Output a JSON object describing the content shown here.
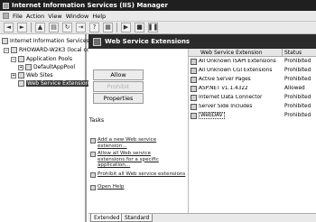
{
  "window": {
    "title": "Internet Information Services (IIS) Manager"
  },
  "menu": [
    "File",
    "Action",
    "View",
    "Window",
    "Help"
  ],
  "toolbar": {
    "back": "◄",
    "forward": "►",
    "up": "▲",
    "props": "▤",
    "refresh": "↻",
    "export": "⇥",
    "help": "?",
    "view": "▦",
    "play": "▶",
    "stop": "■",
    "pause": "❚❚"
  },
  "tree": {
    "items": [
      {
        "label": "Internet Information Services",
        "expander": ""
      },
      {
        "label": "RHOWARD-W2K3 (local cor",
        "expander": "−"
      },
      {
        "label": "Application Pools",
        "expander": "−"
      },
      {
        "label": "DefaultAppPool",
        "expander": "+"
      },
      {
        "label": "Web Sites",
        "expander": "+"
      },
      {
        "label": "Web Service Extension",
        "expander": ""
      }
    ]
  },
  "banner": {
    "title": "Web Service Extensions"
  },
  "buttons": {
    "allow": "Allow",
    "prohibit": "Prohibit",
    "properties": "Properties"
  },
  "tasks": {
    "title": "Tasks",
    "items": [
      {
        "label": "Add a new Web service extension..."
      },
      {
        "label": "Allow all Web service extensions for a specific application..."
      },
      {
        "label": "Prohibit all Web service extensions"
      },
      {
        "label": "Open Help"
      }
    ]
  },
  "list": {
    "columns": {
      "name": "Web Service Extension",
      "status": "Status"
    },
    "rows": [
      {
        "name": "All Unknown ISAPI Extensions",
        "status": "Prohibited"
      },
      {
        "name": "All Unknown CGI Extensions",
        "status": "Prohibited"
      },
      {
        "name": "Active Server Pages",
        "status": "Prohibited"
      },
      {
        "name": "ASP.NET v1.1.4322",
        "status": "Allowed"
      },
      {
        "name": "Internet Data Connector",
        "status": "Prohibited"
      },
      {
        "name": "Server Side Includes",
        "status": "Prohibited"
      },
      {
        "name": "WebDAV",
        "status": "Prohibited"
      }
    ]
  },
  "tabs": {
    "extended": "Extended",
    "standard": "Standard"
  }
}
